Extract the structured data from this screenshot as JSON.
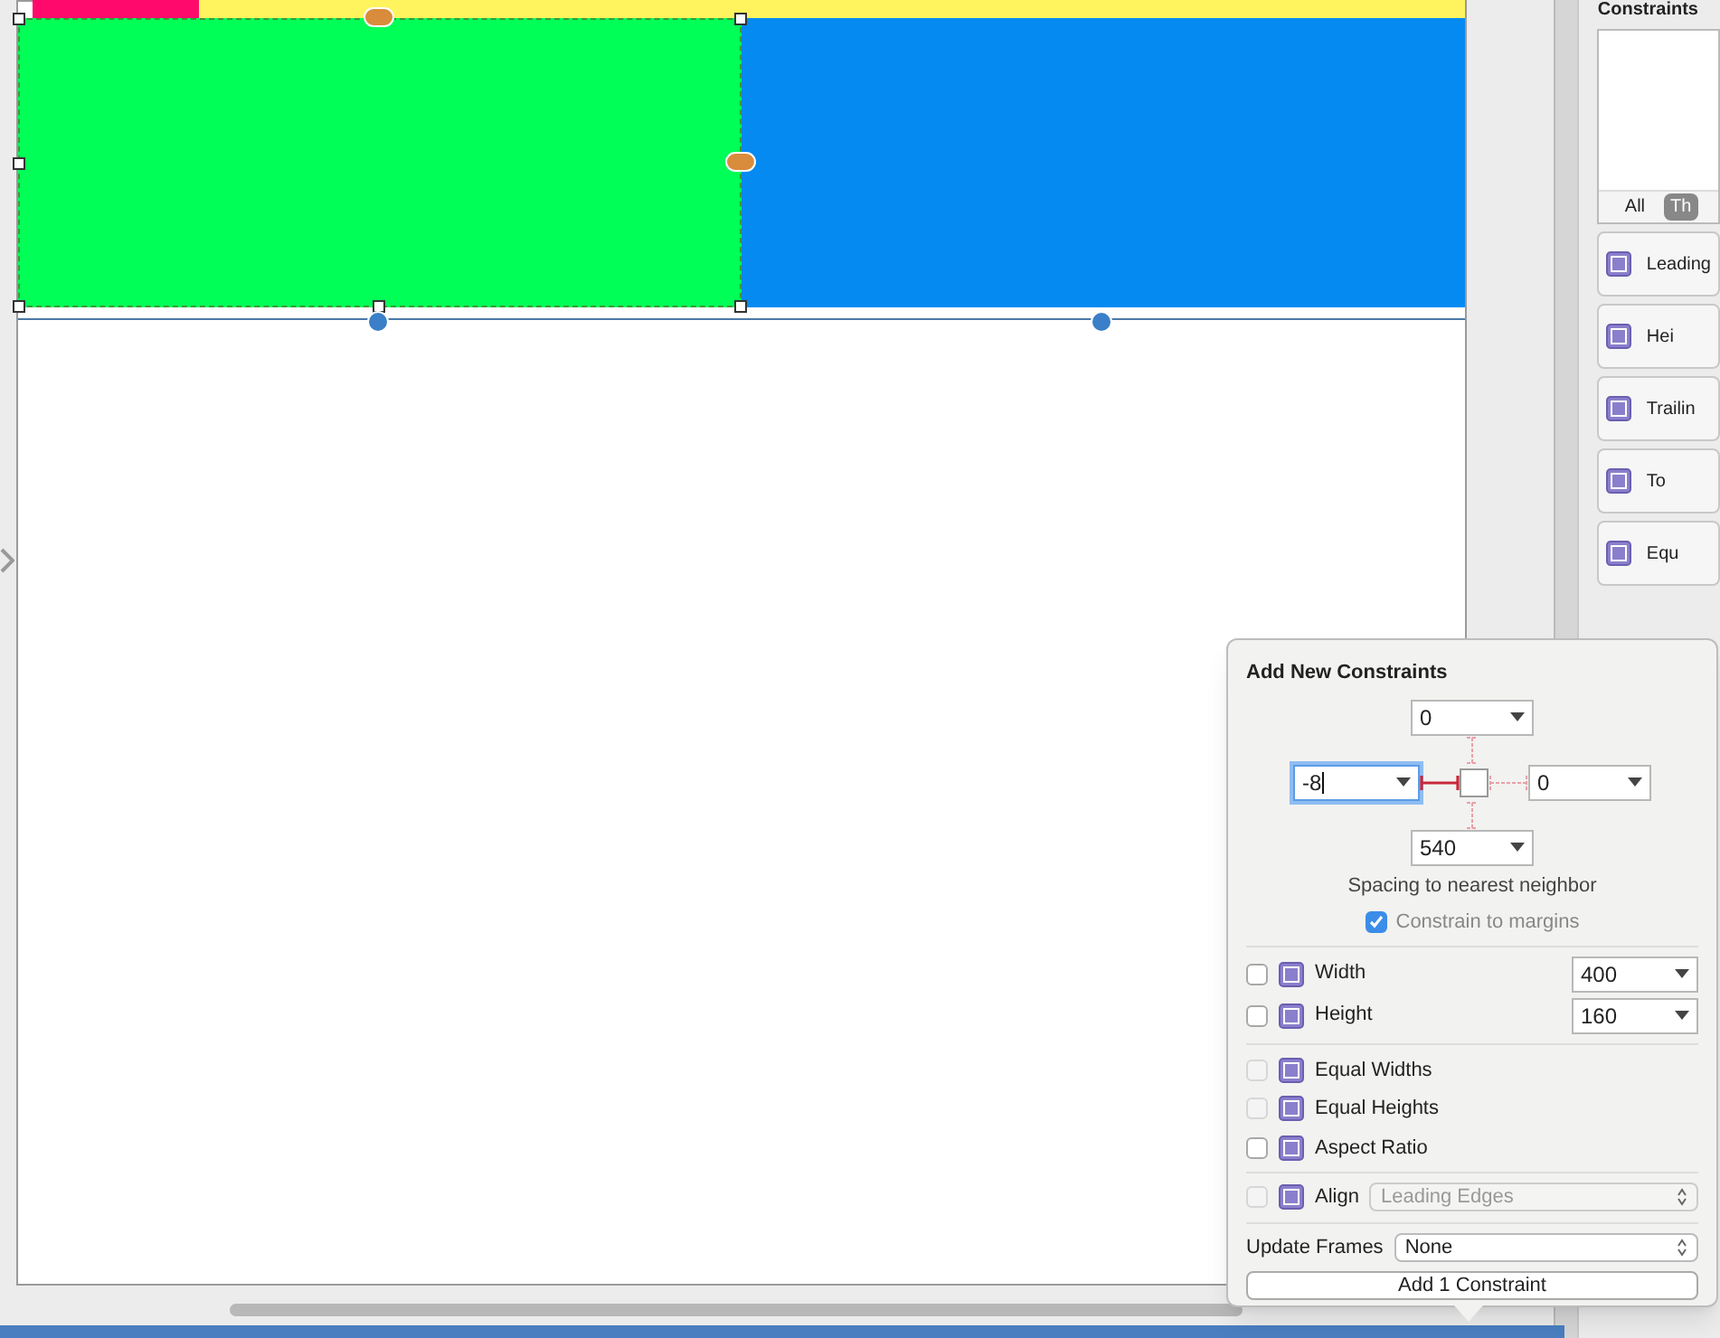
{
  "inspector": {
    "section_title": "Constraints",
    "filter_tabs": [
      {
        "label": "All",
        "selected": false
      },
      {
        "label": "Th",
        "selected": true
      }
    ],
    "constraints": [
      "Leading",
      "Hei",
      "Trailin",
      "To",
      "Equ"
    ]
  },
  "popover": {
    "title": "Add New Constraints",
    "pins": {
      "top": {
        "value": "0",
        "on": false
      },
      "left": {
        "value": "-8",
        "on": true,
        "focused": true
      },
      "right": {
        "value": "0",
        "on": false
      },
      "bottom": {
        "value": "540",
        "on": false
      }
    },
    "caption": "Spacing to nearest neighbor",
    "margins": {
      "label": "Constrain to margins",
      "checked": true
    },
    "size_rows": [
      {
        "label": "Width",
        "value": "400",
        "checked": false
      },
      {
        "label": "Height",
        "value": "160",
        "checked": false
      }
    ],
    "equal_rows": [
      {
        "label": "Equal Widths",
        "checked": false,
        "disabled": true
      },
      {
        "label": "Equal Heights",
        "checked": false,
        "disabled": true
      },
      {
        "label": "Aspect Ratio",
        "checked": false,
        "disabled": false
      }
    ],
    "align": {
      "label": "Align",
      "value": "Leading Edges",
      "checked": false,
      "disabled": true
    },
    "update_frames": {
      "label": "Update Frames",
      "value": "None"
    },
    "add_button": "Add 1 Constraint"
  }
}
